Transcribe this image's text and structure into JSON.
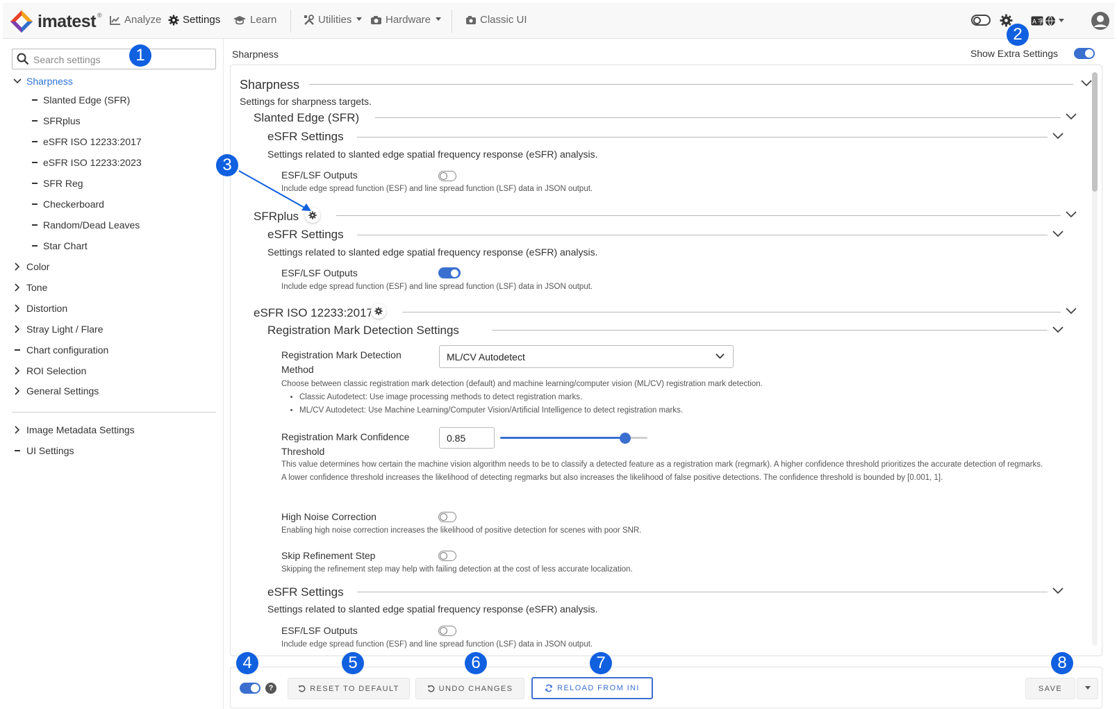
{
  "nav": {
    "logo_text": "imatest",
    "logo_reg": "®",
    "items": [
      {
        "label": "Analyze"
      },
      {
        "label": "Settings"
      },
      {
        "label": "Learn"
      },
      {
        "label": "Utilities"
      },
      {
        "label": "Hardware"
      },
      {
        "label": "Classic UI"
      }
    ]
  },
  "sidebar": {
    "search_placeholder": "Search settings",
    "tree": [
      {
        "label": "Sharpness",
        "expanded": true,
        "active": true
      },
      {
        "label": "Slanted Edge (SFR)"
      },
      {
        "label": "SFRplus"
      },
      {
        "label": "eSFR ISO 12233:2017"
      },
      {
        "label": "eSFR ISO 12233:2023"
      },
      {
        "label": "SFR Reg"
      },
      {
        "label": "Checkerboard"
      },
      {
        "label": "Random/Dead Leaves"
      },
      {
        "label": "Star Chart"
      },
      {
        "label": "Color"
      },
      {
        "label": "Tone"
      },
      {
        "label": "Distortion"
      },
      {
        "label": "Stray Light / Flare"
      },
      {
        "label": "Chart configuration"
      },
      {
        "label": "ROI Selection"
      },
      {
        "label": "General Settings"
      },
      {
        "label": "Image Metadata Settings"
      },
      {
        "label": "UI Settings"
      }
    ]
  },
  "main": {
    "breadcrumb": "Sharpness",
    "show_extra_label": "Show Extra Settings",
    "show_extra_on": true,
    "sections": {
      "sharpness_title": "Sharpness",
      "sharpness_desc": "Settings for sharpness targets.",
      "slanted_title": "Slanted Edge (SFR)",
      "esfr_settings_title": "eSFR Settings",
      "esfr_settings_desc": "Settings related to slanted edge spatial frequency response (eSFR) analysis.",
      "esf_label": "ESF/LSF Outputs",
      "esf_help": "Include edge spread function (ESF) and line spread function (LSF) data in JSON output.",
      "sfrplus_title": "SFRplus",
      "esfr2017_title": "eSFR ISO 12233:2017",
      "regmark_title": "Registration Mark Detection Settings",
      "regmark_method_label": "Registration Mark Detection Method",
      "regmark_method_value": "ML/CV Autodetect",
      "regmark_method_help": "Choose between classic registration mark detection (default) and machine learning/computer vision (ML/CV) registration mark detection.",
      "regmark_bullets": [
        "Classic Autodetect: Use image processing methods to detect registration marks.",
        "ML/CV Autodetect: Use Machine Learning/Computer Vision/Artificial Intelligence to detect registration marks."
      ],
      "confidence_label": "Registration Mark Confidence Threshold",
      "confidence_value": "0.85",
      "confidence_help": "This value determines how certain the machine vision algorithm needs to be to classify a detected feature as a registration mark (regmark). A higher confidence threshold prioritizes the accurate detection of regmarks. A lower confidence threshold increases the likelihood of detecting regmarks but also increases the likelihood of false positive detections. The confidence threshold is bounded by [0.001, 1].",
      "noise_label": "High Noise Correction",
      "noise_help": "Enabling high noise correction increases the likelihood of positive detection for scenes with poor SNR.",
      "skip_label": "Skip Refinement Step",
      "skip_help": "Skipping the refinement step may help with failing detection at the cost of less accurate localization."
    },
    "toggles": {
      "slanted_esf_on": false,
      "sfrplus_esf_on": true,
      "noise_on": false,
      "skip_on": false,
      "esfr2017_esf_on": false
    },
    "slider_fraction": 0.85
  },
  "footer": {
    "reset_label": "RESET TO DEFAULT",
    "undo_label": "UNDO CHANGES",
    "reload_label": "RELOAD FROM INI",
    "save_label": "SAVE"
  },
  "annotations": [
    "1",
    "2",
    "3",
    "4",
    "5",
    "6",
    "7",
    "8"
  ],
  "colors": {
    "accent": "#3a6fd0",
    "annotation": "#1060e0",
    "active_nav": "#2f73d6"
  },
  "icons": [
    "chart-icon",
    "gear-icon",
    "graduation-cap-icon",
    "tools-icon",
    "camera-icon",
    "classic-ui-icon",
    "theme-toggle-icon",
    "settings-gear-icon",
    "language-icon",
    "globe-icon",
    "user-avatar-icon",
    "search-icon",
    "chevron-down-icon",
    "chevron-right-icon",
    "undo-icon",
    "reload-icon",
    "help-icon"
  ]
}
